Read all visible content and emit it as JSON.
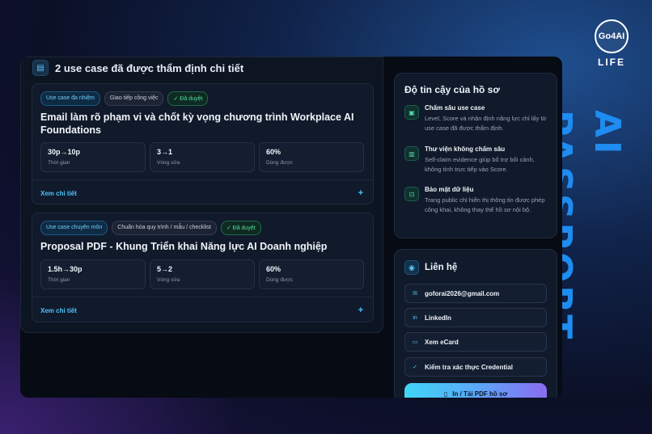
{
  "brand": {
    "badge": "Go4AI",
    "life": "LIFE",
    "vertical_title": "AI PASSPORT"
  },
  "use_cases": {
    "title": "2 use case đã được thẩm định chi tiết",
    "icon": "document-icon",
    "items": [
      {
        "tags": [
          "Use case đa nhiệm",
          "Giao tiếp công việc",
          "✓ Đã duyệt"
        ],
        "title": "Email làm rõ phạm vi và chốt kỳ vọng chương trình Workplace AI Foundations",
        "stats": [
          {
            "value": "30p→10p",
            "label": "Thời gian"
          },
          {
            "value": "3→1",
            "label": "Vòng sửa"
          },
          {
            "value": "60%",
            "label": "Dùng được"
          }
        ],
        "detail": "Xem chi tiết",
        "plus": "+"
      },
      {
        "tags": [
          "Use case chuyên môn",
          "Chuẩn hóa quy trình / mẫu / checklist",
          "✓ Đã duyệt"
        ],
        "title": "Proposal PDF - Khung Triển khai Năng lực AI Doanh nghiệp",
        "stats": [
          {
            "value": "1.5h→30p",
            "label": "Thời gian"
          },
          {
            "value": "5→2",
            "label": "Vòng sửa"
          },
          {
            "value": "60%",
            "label": "Dùng được"
          }
        ],
        "detail": "Xem chi tiết",
        "plus": "+"
      }
    ]
  },
  "trust": {
    "title": "Độ tin cậy của hồ sơ",
    "items": [
      {
        "icon": "check-list-icon",
        "head": "Chấm sâu use case",
        "desc": "Level, Score và nhận định năng lực chỉ lấy từ use case đã được thẩm định."
      },
      {
        "icon": "library-icon",
        "head": "Thư viện không chấm sâu",
        "desc": "Self-claim evidence giúp bổ trợ bối cảnh, không tính trực tiếp vào Score."
      },
      {
        "icon": "lock-icon",
        "head": "Bảo mật dữ liệu",
        "desc": "Trang public chỉ hiển thị thông tin được phép công khai, không thay thế hồ sơ nội bộ."
      }
    ]
  },
  "contact": {
    "title": "Liên hệ",
    "buttons": [
      {
        "icon": "mail-icon",
        "glyph": "✉",
        "label": "goforai2026@gmail.com"
      },
      {
        "icon": "linkedin-icon",
        "glyph": "in",
        "label": "LinkedIn"
      },
      {
        "icon": "card-icon",
        "glyph": "▭",
        "label": "Xem eCard"
      },
      {
        "icon": "check-icon",
        "glyph": "✓",
        "label": "Kiểm tra xác thực Credential"
      }
    ],
    "pdf_label": "In / Tải PDF hồ sơ"
  }
}
